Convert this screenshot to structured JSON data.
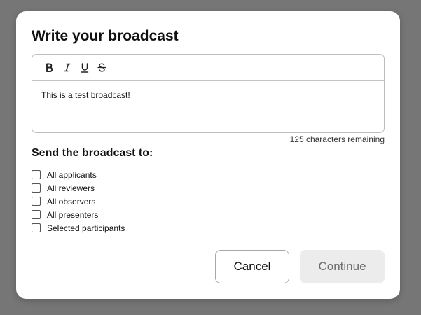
{
  "dialog": {
    "title": "Write your broadcast",
    "editor": {
      "toolbar": [
        {
          "name": "bold-icon",
          "label": "Bold"
        },
        {
          "name": "italic-icon",
          "label": "Italic"
        },
        {
          "name": "underline-icon",
          "label": "Underline"
        },
        {
          "name": "strikethrough-icon",
          "label": "Strikethrough"
        }
      ],
      "content": "This is a test broadcast!",
      "remaining": "125 characters remaining"
    },
    "recipients": {
      "label": "Send the broadcast to:",
      "options": [
        {
          "label": "All applicants",
          "checked": false
        },
        {
          "label": "All reviewers",
          "checked": false
        },
        {
          "label": "All observers",
          "checked": false
        },
        {
          "label": "All presenters",
          "checked": false
        },
        {
          "label": "Selected participants",
          "checked": false
        }
      ]
    },
    "actions": {
      "cancel_label": "Cancel",
      "continue_label": "Continue",
      "continue_enabled": false
    }
  },
  "colors": {
    "backdrop": "#767676",
    "surface": "#ffffff",
    "disabled_button_bg": "#ececec",
    "disabled_button_text": "#6e6e6e"
  }
}
